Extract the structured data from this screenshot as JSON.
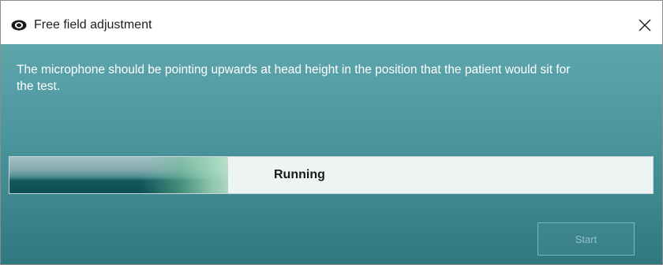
{
  "window": {
    "title": "Free field adjustment",
    "icon": "speaker-icon",
    "close_icon": "close-icon"
  },
  "content": {
    "message": "The microphone should be pointing upwards at head height in the position that the patient would sit for the test."
  },
  "progress": {
    "label": "Running",
    "value_fraction": 0.34
  },
  "actions": {
    "start_label": "Start",
    "start_enabled": false
  },
  "colors": {
    "panel_top": "#5ea6ac",
    "panel_bottom": "#2f7880",
    "progress_fill": "#0e4f55",
    "progress_track": "#eef3f4"
  }
}
